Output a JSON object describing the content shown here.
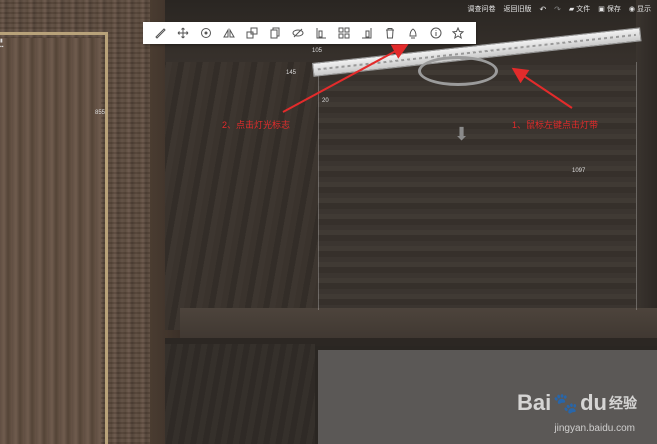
{
  "topbar": {
    "survey": "调查问卷",
    "back_old": "返回旧版",
    "undo_icon": "undo-icon",
    "redo_icon": "redo-icon",
    "file": "文件",
    "save": "保存",
    "display": "显示"
  },
  "toolbar": {
    "tools": [
      "ruler-icon",
      "move-icon",
      "rotate-icon",
      "mirror-icon",
      "scale-icon",
      "copy-icon",
      "hide-icon",
      "align-left-icon",
      "group-icon",
      "align-right-icon",
      "delete-icon",
      "light-icon",
      "info-icon",
      "favorite-icon"
    ]
  },
  "annotations": {
    "step1": "1、鼠标左键点击灯带",
    "step2": "2、点击灯光标志",
    "color": "#e32b2b"
  },
  "dimensions": {
    "d1": "105",
    "d2": "145",
    "d3": "855",
    "d4": "20",
    "d5": "1097"
  },
  "watermark": {
    "brand": "Bai",
    "brand2": "du",
    "jingyan": "经验",
    "url": "jingyan.baidu.com"
  }
}
